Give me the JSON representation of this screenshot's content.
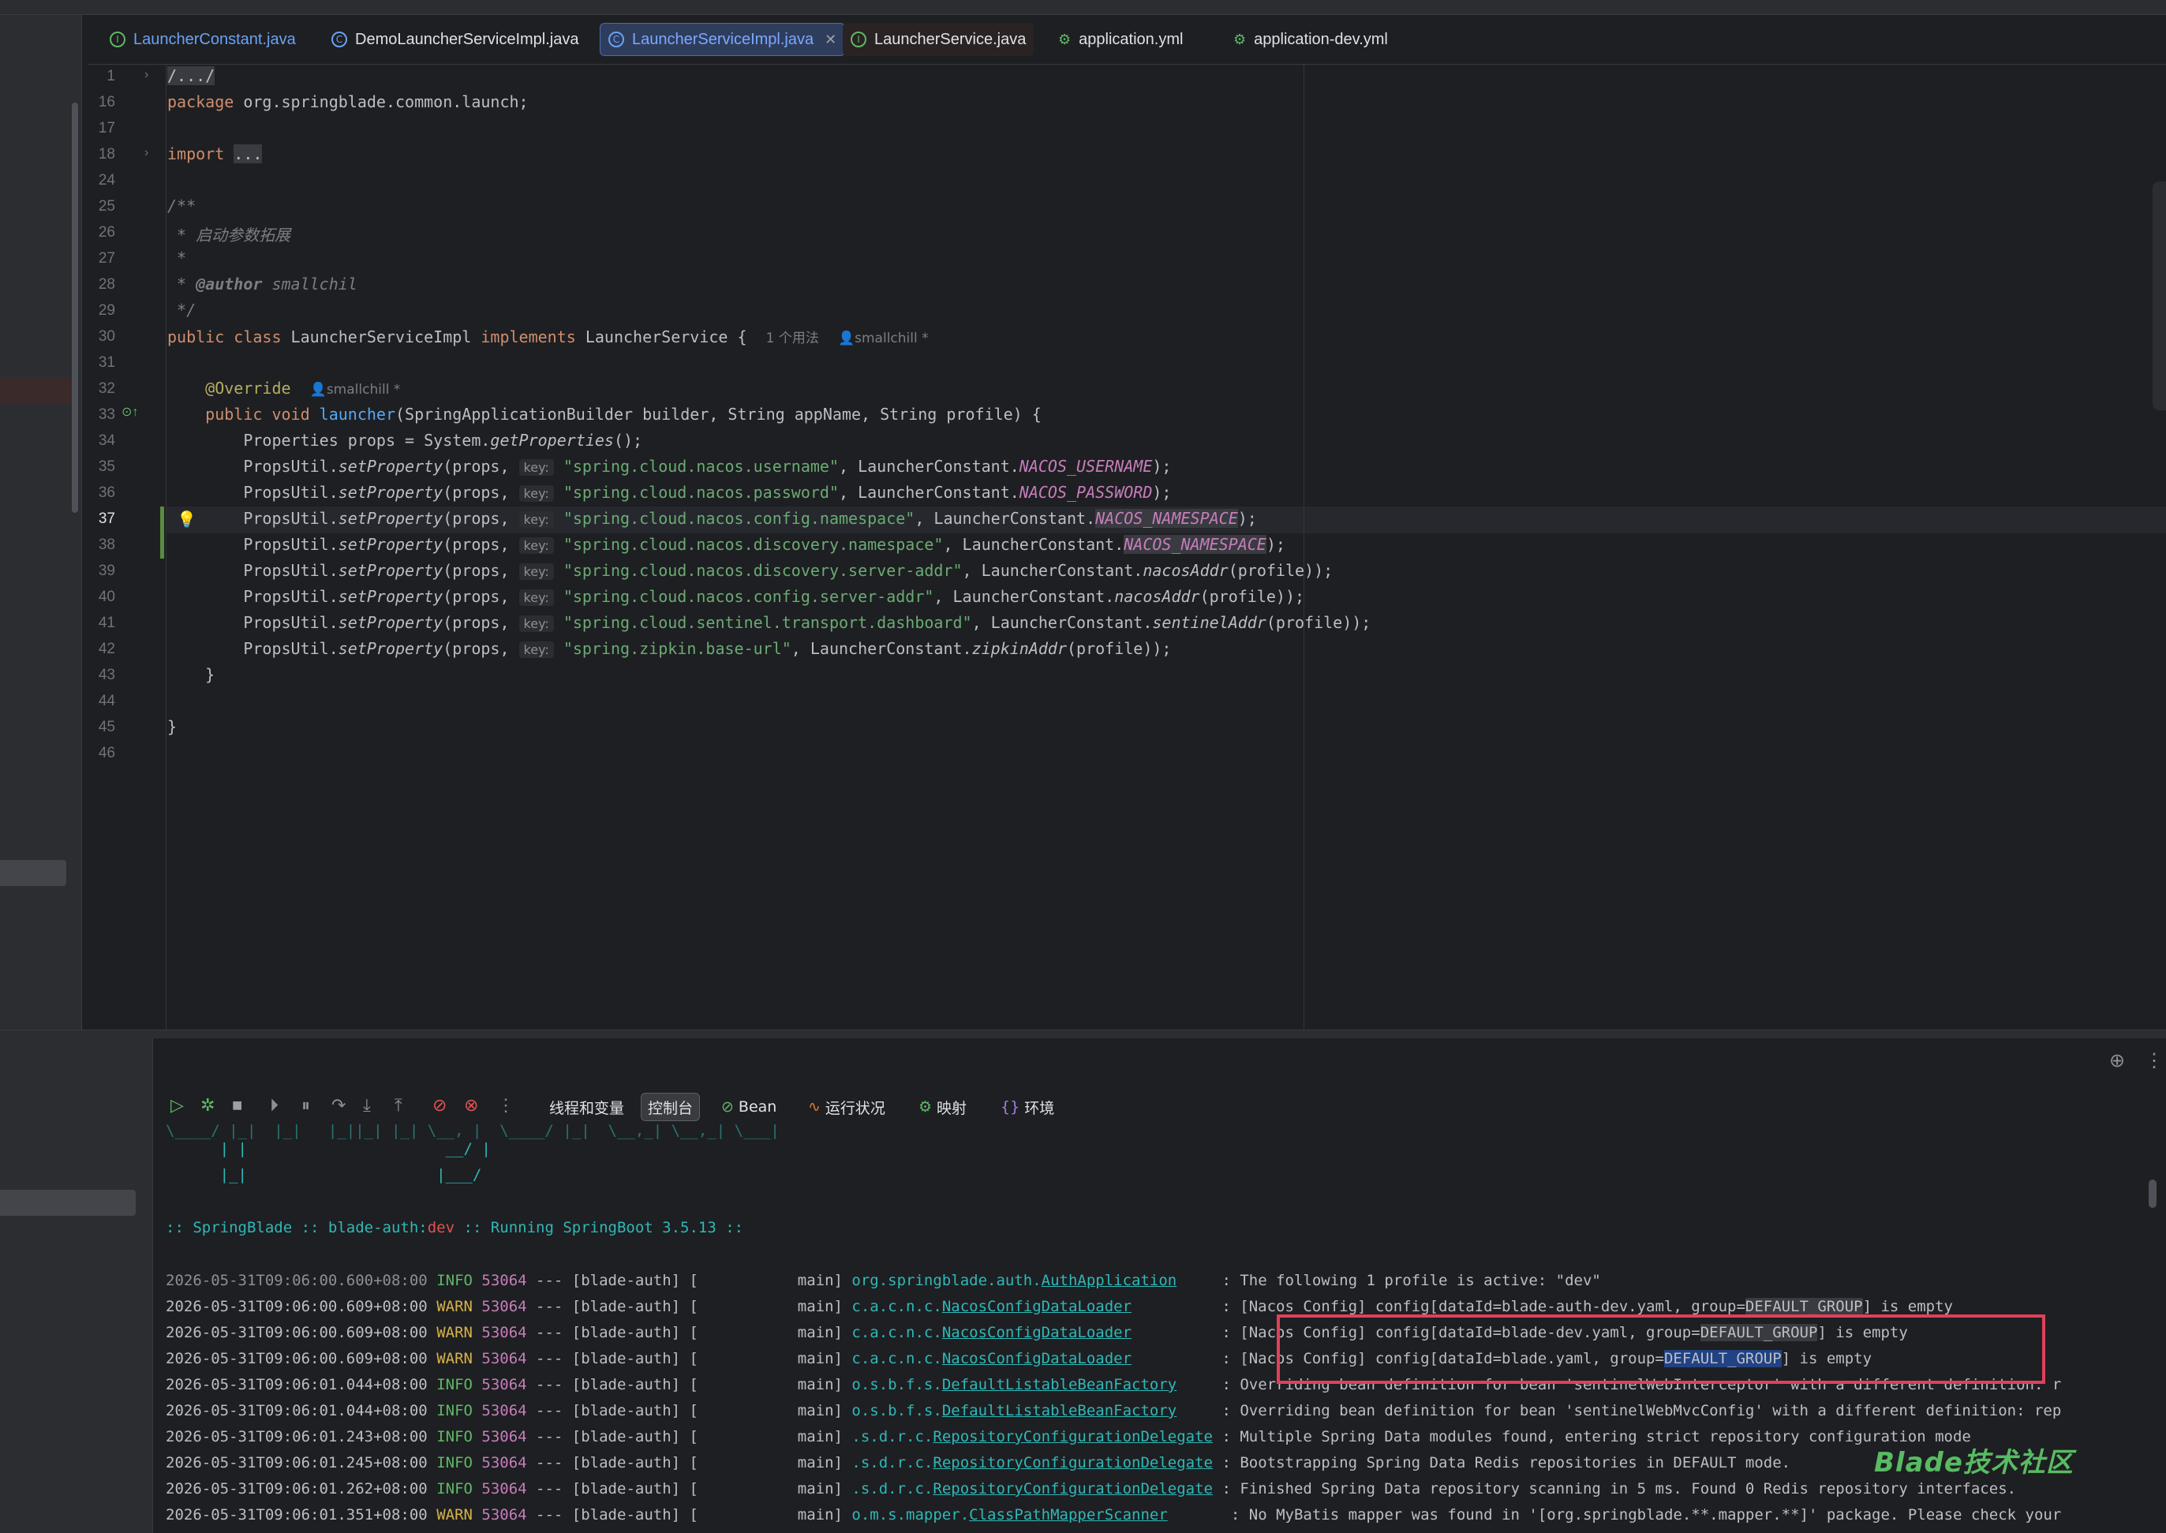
{
  "tabs": [
    {
      "label": "LauncherConstant.java",
      "icon": "interface-icon"
    },
    {
      "label": "DemoLauncherServiceImpl.java",
      "icon": "class-icon"
    },
    {
      "label": "LauncherServiceImpl.java",
      "icon": "class-icon",
      "active": true
    },
    {
      "label": "LauncherService.java",
      "icon": "interface-icon"
    },
    {
      "label": "application.yml",
      "icon": "yaml-icon"
    },
    {
      "label": "application-dev.yml",
      "icon": "yaml-icon"
    }
  ],
  "editor": {
    "line_numbers": [
      "1",
      "16",
      "17",
      "18",
      "24",
      "25",
      "26",
      "27",
      "28",
      "29",
      "30",
      "31",
      "32",
      "33",
      "34",
      "35",
      "36",
      "37",
      "38",
      "39",
      "40",
      "41",
      "42",
      "43",
      "44",
      "45",
      "46"
    ],
    "current_line": "37",
    "usages_hint": "1 个用法",
    "author_hint": "smallchill *",
    "param_hint": "key:",
    "lines": {
      "l1": "/.../",
      "l16_kw": "package",
      "l16_rest": " org.springblade.common.launch;",
      "l18_kw": "import",
      "l18_fold": "...",
      "l25": "/**",
      "l26": " * 启动参数拓展",
      "l27": " *",
      "l28_a": " * ",
      "l28_tag": "@author",
      "l28_b": " smallchil",
      "l29": " */",
      "l30_a": "public class",
      "l30_b": " LauncherServiceImpl ",
      "l30_c": "implements",
      "l30_d": " LauncherService {",
      "l32_ann": "@Override",
      "l33_a": "public void",
      "l33_m": "launcher",
      "l33_b": "(SpringApplicationBuilder builder, String appName, String profile) {",
      "l34_a": "Properties props = System.",
      "l34_m": "getProperties",
      "l34_b": "();",
      "set_a": "PropsUtil.",
      "set_m": "setProperty",
      "set_b": "(props, ",
      "lc": ", LauncherConstant.",
      "prof": "(profile));",
      "k35": "\"spring.cloud.nacos.username\"",
      "c35": "NACOS_USERNAME",
      "k36": "\"spring.cloud.nacos.password\"",
      "c36": "NACOS_PASSWORD",
      "k37": "\"spring.cloud.nacos.config.namespace\"",
      "c37": "NACOS_NAMESPACE",
      "k38": "\"spring.cloud.nacos.discovery.namespace\"",
      "c38": "NACOS_NAMESPACE",
      "k39": "\"spring.cloud.nacos.discovery.server-addr\"",
      "m39": "nacosAddr",
      "k40": "\"spring.cloud.nacos.config.server-addr\"",
      "m40": "nacosAddr",
      "k41": "\"spring.cloud.sentinel.transport.dashboard\"",
      "m41": "sentinelAddr",
      "k42": "\"spring.zipkin.base-url\"",
      "m42": "zipkinAddr",
      "end_paren": ");",
      "close_brace": "}"
    }
  },
  "toolbar": {
    "tabs": [
      {
        "label": "线程和变量"
      },
      {
        "label": "控制台",
        "active": true
      },
      {
        "label": "Bean"
      },
      {
        "label": "运行状况"
      },
      {
        "label": "映射"
      },
      {
        "label": "环境"
      }
    ]
  },
  "console": {
    "banner": {
      "b0": "\\____/ |_|  |_|   |_||_| |_| \\__, |  \\____/ |_|  \\__,_| \\__,_| \\___|",
      "b1": "      | |                      __/ |",
      "b2": "      |_|                     |___/",
      "b3_a": ":: SpringBlade :: blade-auth:",
      "b3_dev": "dev",
      "b3_b": " :: Running SpringBoot 3.5.13 ::"
    },
    "sep": " --- [blade-auth] [           main] ",
    "logs": [
      {
        "ts": "2026-05-31T09:06:00.600+08:00",
        "level": "INFO",
        "pid": "53064",
        "logger_prefix": "org.springblade.auth.",
        "logger_name": "AuthApplication",
        "pad": "     ",
        "msg_a": ": The following 1 profile is active: \"dev\"",
        "hl": "",
        "msg_b": ""
      },
      {
        "ts": "2026-05-31T09:06:00.609+08:00",
        "level": "WARN",
        "pid": "53064",
        "logger_prefix": "c.a.c.n.c.",
        "logger_name": "NacosConfigDataLoader",
        "pad": "          ",
        "msg_a": ": [Nacos Config] config[dataId=blade-auth-dev.yaml, group=",
        "hl": "DEFAULT_GROUP",
        "msg_b": "] is empty"
      },
      {
        "ts": "2026-05-31T09:06:00.609+08:00",
        "level": "WARN",
        "pid": "53064",
        "logger_prefix": "c.a.c.n.c.",
        "logger_name": "NacosConfigDataLoader",
        "pad": "          ",
        "msg_a": ": [Nacos Config] config[dataId=blade-dev.yaml, group=",
        "hl": "DEFAULT_GROUP",
        "msg_b": "] is empty"
      },
      {
        "ts": "2026-05-31T09:06:00.609+08:00",
        "level": "WARN",
        "pid": "53064",
        "logger_prefix": "c.a.c.n.c.",
        "logger_name": "NacosConfigDataLoader",
        "pad": "          ",
        "msg_a": ": [Nacos Config] config[dataId=blade.yaml, group=",
        "hl": "DEFAULT_GROUP",
        "msg_b": "] is empty"
      },
      {
        "ts": "2026-05-31T09:06:01.044+08:00",
        "level": "INFO",
        "pid": "53064",
        "logger_prefix": "o.s.b.f.s.",
        "logger_name": "DefaultListableBeanFactory",
        "pad": "     ",
        "msg_a": ": Overriding bean definition for bean 'sentinelWebInterceptor' with a different definition: r",
        "hl": "",
        "msg_b": ""
      },
      {
        "ts": "2026-05-31T09:06:01.044+08:00",
        "level": "INFO",
        "pid": "53064",
        "logger_prefix": "o.s.b.f.s.",
        "logger_name": "DefaultListableBeanFactory",
        "pad": "     ",
        "msg_a": ": Overriding bean definition for bean 'sentinelWebMvcConfig' with a different definition: rep",
        "hl": "",
        "msg_b": ""
      },
      {
        "ts": "2026-05-31T09:06:01.243+08:00",
        "level": "INFO",
        "pid": "53064",
        "logger_prefix": ".s.d.r.c.",
        "logger_name": "RepositoryConfigurationDelegate",
        "pad": " ",
        "msg_a": ": Multiple Spring Data modules found, entering strict repository configuration mode",
        "hl": "",
        "msg_b": ""
      },
      {
        "ts": "2026-05-31T09:06:01.245+08:00",
        "level": "INFO",
        "pid": "53064",
        "logger_prefix": ".s.d.r.c.",
        "logger_name": "RepositoryConfigurationDelegate",
        "pad": " ",
        "msg_a": ": Bootstrapping Spring Data Redis repositories in DEFAULT mode.",
        "hl": "",
        "msg_b": ""
      },
      {
        "ts": "2026-05-31T09:06:01.262+08:00",
        "level": "INFO",
        "pid": "53064",
        "logger_prefix": ".s.d.r.c.",
        "logger_name": "RepositoryConfigurationDelegate",
        "pad": " ",
        "msg_a": ": Finished Spring Data repository scanning in 5 ms. Found 0 Redis repository interfaces.",
        "hl": "",
        "msg_b": ""
      },
      {
        "ts": "2026-05-31T09:06:01.351+08:00",
        "level": "WARN",
        "pid": "53064",
        "logger_prefix": "o.m.s.mapper.",
        "logger_name": "ClassPathMapperScanner",
        "pad": "       ",
        "msg_a": ": No MyBatis mapper was found in '[org.springblade.**.mapper.**]' package. Please check your",
        "hl": "",
        "msg_b": ""
      }
    ]
  },
  "watermark": "Blade技术社区",
  "colors": {
    "accent": "#4a6bb3",
    "info": "#5fb865",
    "warn": "#d6b24a",
    "highlight_box": "#e0405a"
  }
}
